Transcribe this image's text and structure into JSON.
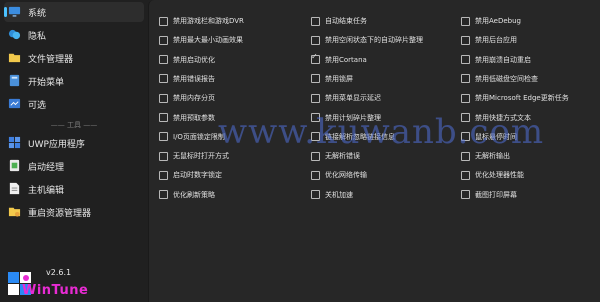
{
  "sidebar": {
    "items": [
      {
        "label": "系统",
        "icon": "monitor-icon"
      },
      {
        "label": "隐私",
        "icon": "privacy-icon"
      },
      {
        "label": "文件管理器",
        "icon": "folder-icon"
      },
      {
        "label": "开始菜单",
        "icon": "start-menu-icon"
      },
      {
        "label": "可选",
        "icon": "optional-icon"
      }
    ],
    "divider": "—— 工具 ——",
    "tools": [
      {
        "label": "UWP应用程序",
        "icon": "uwp-apps-icon"
      },
      {
        "label": "启动经理",
        "icon": "startup-icon"
      },
      {
        "label": "主机编辑",
        "icon": "hosts-icon"
      },
      {
        "label": "重启资源管理器",
        "icon": "restart-explorer-icon"
      }
    ]
  },
  "options": {
    "col1": [
      {
        "label": "禁用游戏栏和游戏DVR",
        "checked": false
      },
      {
        "label": "禁用最大最小动画效果",
        "checked": false
      },
      {
        "label": "禁用启动优化",
        "checked": false
      },
      {
        "label": "禁用错误报告",
        "checked": false
      },
      {
        "label": "禁用内存分页",
        "checked": false
      },
      {
        "label": "禁用预取参数",
        "checked": false
      },
      {
        "label": "I/O页面锁定限制",
        "checked": false
      },
      {
        "label": "无鼠标时打开方式",
        "checked": false
      },
      {
        "label": "启动时数字锁定",
        "checked": false
      },
      {
        "label": "优化刷新策略",
        "checked": false
      }
    ],
    "col2": [
      {
        "label": "自动结束任务",
        "checked": false
      },
      {
        "label": "禁用空闲状态下的自动碎片整理",
        "checked": false
      },
      {
        "label": "禁用Cortana",
        "checked": true
      },
      {
        "label": "禁用锁屏",
        "checked": false
      },
      {
        "label": "禁用菜单显示延迟",
        "checked": false
      },
      {
        "label": "禁用计划碎片整理",
        "checked": false
      },
      {
        "label": "链接解析忽略链接信息",
        "checked": false
      },
      {
        "label": "无解析错误",
        "checked": false
      },
      {
        "label": "优化网络传输",
        "checked": false
      },
      {
        "label": "关机加速",
        "checked": false
      }
    ],
    "col3": [
      {
        "label": "禁用AeDebug",
        "checked": false
      },
      {
        "label": "禁用后台应用",
        "checked": false
      },
      {
        "label": "禁用崩溃自动重启",
        "checked": false
      },
      {
        "label": "禁用低磁盘空间检查",
        "checked": false
      },
      {
        "label": "禁用Microsoft Edge更新任务",
        "checked": false
      },
      {
        "label": "禁用快捷方式文本",
        "checked": false
      },
      {
        "label": "鼠标悬停时间",
        "checked": false
      },
      {
        "label": "无解析输出",
        "checked": false
      },
      {
        "label": "优化处理器性能",
        "checked": false
      },
      {
        "label": "截图打印屏幕",
        "checked": false
      }
    ]
  },
  "watermark": "www.kuwanb.com",
  "app": {
    "version": "v2.6.1",
    "name": "WinTune"
  },
  "colors": {
    "accent": "#4cc2ff",
    "brand": "#e82bd3",
    "watermark": "#4f6fd6"
  }
}
